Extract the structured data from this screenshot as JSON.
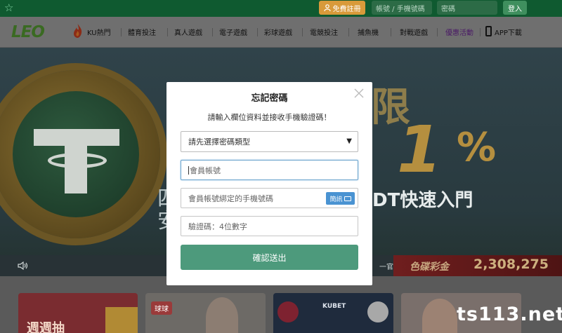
{
  "topbar": {
    "register_label": "免費註冊",
    "account_placeholder": "帳號 / 手機號碼",
    "password_placeholder": "密碼",
    "login_label": "登入"
  },
  "nav": {
    "logo": "LEO",
    "items": [
      {
        "label": "KU熱門"
      },
      {
        "label": "體育投注"
      },
      {
        "label": "真人遊戲"
      },
      {
        "label": "電子遊戲"
      },
      {
        "label": "彩球遊戲"
      },
      {
        "label": "電競投注"
      },
      {
        "label": "捕魚機"
      },
      {
        "label": "對戰遊戲"
      },
      {
        "label": "優惠活動"
      },
      {
        "label": "APP下載"
      }
    ]
  },
  "hero": {
    "headline_char": "限",
    "big_number": "1",
    "percent": "%",
    "left_char_1": "四",
    "left_char_2": "安",
    "subtitle": "DT快速入門",
    "ticker_fragment": "一官:",
    "jackpot_label": "色碟彩金",
    "jackpot_value": "2,308,275"
  },
  "cards": {
    "card1_title": "週週抽",
    "card2_tag": "球球",
    "card3_brand": "KUBET"
  },
  "watermark": "ts113.net",
  "modal": {
    "title": "忘記密碼",
    "description": "請輸入欄位資料並接收手機驗證碼！",
    "select_value": "請先選擇密碼類型",
    "account_placeholder": "會員帳號",
    "phone_placeholder": "會員帳號綁定的手機號碼",
    "sms_label": "簡訊",
    "code_placeholder": "驗證碼：4位數字",
    "confirm_label": "確認送出"
  },
  "colors": {
    "topbar": "#0f5a30",
    "confirm": "#4d9a7c",
    "sms": "#4a93d2",
    "register": "#d89a3a"
  }
}
